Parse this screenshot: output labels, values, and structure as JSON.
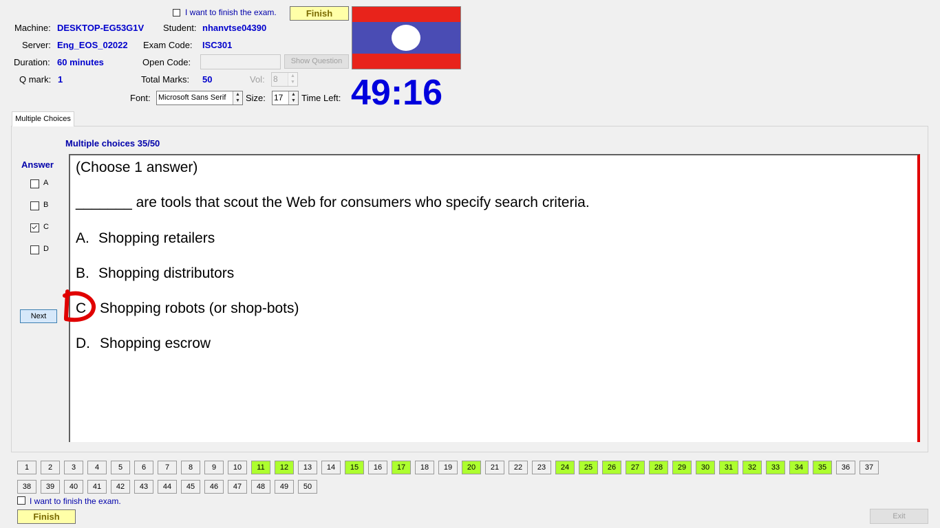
{
  "header": {
    "finish_checkbox_label": "I want to finish the exam.",
    "finish_label": "Finish",
    "machine_label": "Machine:",
    "machine_value": "DESKTOP-EG53G1V",
    "student_label": "Student:",
    "student_value": "nhanvtse04390",
    "server_label": "Server:",
    "server_value": "Eng_EOS_02022",
    "exam_code_label": "Exam Code:",
    "exam_code_value": "ISC301",
    "duration_label": "Duration:",
    "duration_value": "60 minutes",
    "open_code_label": "Open Code:",
    "open_code_value": "",
    "show_question_label": "Show Question",
    "q_mark_label": "Q mark:",
    "q_mark_value": "1",
    "total_marks_label": "Total Marks:",
    "total_marks_value": "50",
    "vol_label": "Vol:",
    "vol_value": "8",
    "font_label": "Font:",
    "font_value": "Microsoft Sans Serif",
    "size_label": "Size:",
    "size_value": "17",
    "time_left_label": "Time Left:",
    "time_left_value": "49:16"
  },
  "colors": {
    "flag_red": "#e8231b",
    "flag_blue": "#4a4cb4",
    "accent_blue": "#0000cc",
    "answered_green": "#adff2f",
    "finish_yellow": "#ffffa8",
    "annotation_red": "#e00000"
  },
  "tab": {
    "label": "Multiple Choices"
  },
  "main": {
    "progress_label": "Multiple choices 35/50",
    "answer_heading": "Answer",
    "options": [
      {
        "label": "A",
        "checked": false
      },
      {
        "label": "B",
        "checked": false
      },
      {
        "label": "C",
        "checked": true
      },
      {
        "label": "D",
        "checked": false
      }
    ],
    "next_label": "Next"
  },
  "question": {
    "instruction": "(Choose 1 answer)",
    "stem": "_______ are tools that scout the Web for consumers who specify search criteria.",
    "choices": [
      {
        "letter": "A.",
        "text": "Shopping retailers"
      },
      {
        "letter": "B.",
        "text": "Shopping distributors"
      },
      {
        "letter": "C",
        "text": "Shopping robots (or shop-bots)"
      },
      {
        "letter": "D.",
        "text": "Shopping escrow"
      }
    ]
  },
  "navigator": {
    "total": 50,
    "answered": [
      11,
      12,
      15,
      17,
      20,
      24,
      25,
      26,
      27,
      28,
      29,
      30,
      31,
      32,
      33,
      34,
      35
    ]
  },
  "footer": {
    "finish_checkbox_label": "I want to finish the exam.",
    "finish_label": "Finish",
    "exit_label": "Exit"
  }
}
